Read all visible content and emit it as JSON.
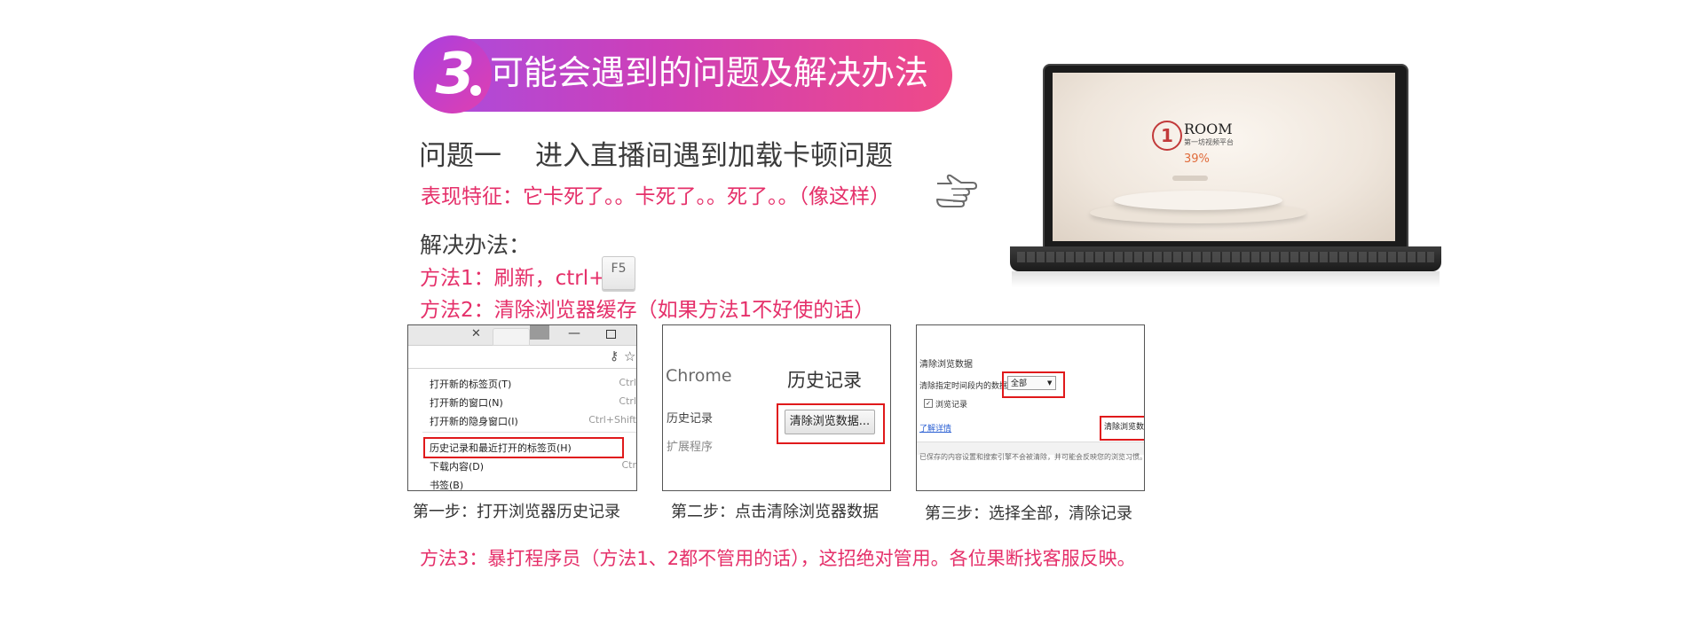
{
  "section": {
    "number": "3",
    "title": "可能会遇到的问题及解决办法"
  },
  "problem": {
    "label": "问题一",
    "title": "进入直播间遇到加载卡顿问题",
    "symptom": "表现特征：它卡死了。。卡死了。。死了。。（像这样）"
  },
  "solution_label": "解决办法：",
  "method1": "方法1：刷新，ctrl+",
  "key_f5": "F5",
  "method2": "方法2：清除浏览器缓存（如果方法1不好使的话）",
  "method3": "方法3：暴打程序员（方法1、2都不管用的话），这招绝对管用。各位果断找客服反映。",
  "steps": [
    {
      "caption": "第一步：打开浏览器历史记录",
      "menu": [
        {
          "label": "打开新的标签页(T)",
          "shortcut": "Ctrl"
        },
        {
          "label": "打开新的窗口(N)",
          "shortcut": "Ctrl"
        },
        {
          "label": "打开新的隐身窗口(I)",
          "shortcut": "Ctrl+Shift"
        },
        {
          "label": "历史记录和最近打开的标签页(H)",
          "shortcut": ""
        },
        {
          "label": "下载内容(D)",
          "shortcut": "Ctr"
        },
        {
          "label": "书签(B)",
          "shortcut": ""
        }
      ]
    },
    {
      "caption": "第二步：点击清除浏览器数据",
      "app": "Chrome",
      "heading": "历史记录",
      "nav": [
        "历史记录",
        "扩展程序"
      ],
      "button": "清除浏览数据..."
    },
    {
      "caption": "第三步：选择全部，清除记录",
      "title": "清除浏览数据",
      "range_label": "清除指定时间段内的数据",
      "range_value": "全部",
      "checkbox": "浏览记录",
      "link": "了解详情",
      "button": "清除浏览数",
      "footer": "已保存的内容设置和搜索引擎不会被清除，并可能会反映您的浏览习惯。"
    }
  ],
  "laptop": {
    "brand": "ROOM",
    "subtitle": "第一坊视频平台",
    "progress_text": "39%"
  },
  "colors": {
    "accent_pink": "#e5306a",
    "banner_start": "#a84de0",
    "banner_end": "#ef4a88",
    "highlight_red": "#e0191b"
  },
  "icons": [
    "pointing-hand-icon",
    "close-icon",
    "key-icon",
    "star-icon",
    "minimize-icon",
    "maximize-icon",
    "person-icon",
    "dropdown-arrow-icon",
    "check-icon"
  ]
}
